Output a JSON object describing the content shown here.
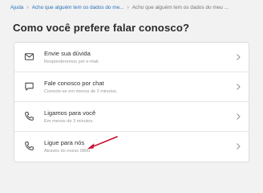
{
  "breadcrumb": {
    "items": [
      "Ajuda",
      "Acho que alguém tem os dados do me...",
      "Acho que alguém tem os dados do meu ..."
    ]
  },
  "page": {
    "title": "Como você prefere falar conosco?"
  },
  "contact_options": [
    {
      "title": "Envie sua dúvida",
      "subtitle": "Responderemos por e-mail.",
      "icon": "envelope-icon"
    },
    {
      "title": "Fale conosco por chat",
      "subtitle": "Conecte-se em menos de 2 minutos.",
      "icon": "chat-bubble-icon"
    },
    {
      "title": "Ligamos para você",
      "subtitle": "Em menos de 3 minutos.",
      "icon": "phone-icon"
    },
    {
      "title": "Ligue para nós",
      "subtitle": "Através do nosso 0800",
      "icon": "phone-icon"
    }
  ],
  "colors": {
    "link": "#2b72b8",
    "annotation_arrow": "#c8102e"
  }
}
